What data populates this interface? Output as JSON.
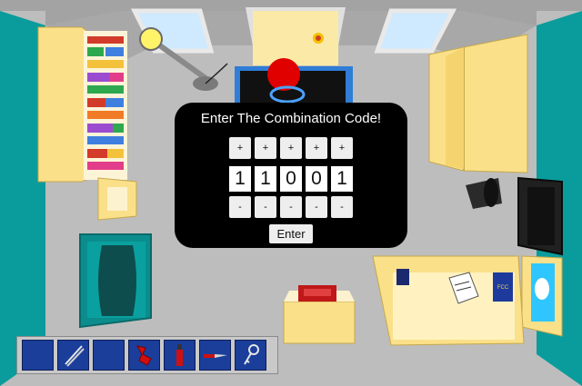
{
  "dialog": {
    "title": "Enter The Combination Code!",
    "increment_label": "+",
    "decrement_label": "-",
    "digits": [
      "1",
      "1",
      "0",
      "0",
      "1"
    ],
    "enter_label": "Enter"
  },
  "inventory": {
    "slots": [
      {
        "item": "empty"
      },
      {
        "item": "chopsticks-icon"
      },
      {
        "item": "empty"
      },
      {
        "item": "red-cloth-icon"
      },
      {
        "item": "red-screwdriver-icon"
      },
      {
        "item": "red-knife-icon"
      },
      {
        "item": "key-icon"
      }
    ]
  },
  "scene": {
    "cabinet_label": "FCC",
    "colors": {
      "wall_teal": "#0a9c9c",
      "ceiling_gray": "#9c9c9c",
      "floor_gray": "#bdbdbd",
      "wood": "#fbe08a",
      "accent_red": "#e80000",
      "inventory_blue": "#1a3e9a"
    }
  }
}
